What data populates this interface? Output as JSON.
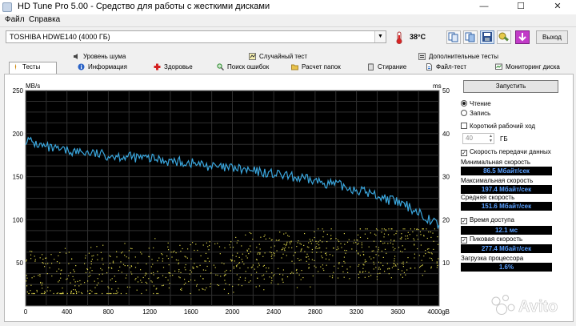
{
  "window": {
    "title": "HD Tune Pro 5.00 - Средство для работы с жесткими дисками",
    "minimize": "—",
    "maximize": "☐",
    "close": "✕"
  },
  "menu": {
    "file": "Файл",
    "help": "Справка"
  },
  "toolbar": {
    "drive": "TOSHIBA HDWE140 (4000 ГБ)",
    "temperature": "38°C",
    "exit_label": "Выход",
    "icons": [
      "copy-icon",
      "copy-all-icon",
      "save-icon",
      "options-icon",
      "download-icon"
    ]
  },
  "tabs": {
    "row1": [
      {
        "label": "Уровень шума",
        "icon": "speaker-icon"
      },
      {
        "label": "Случайный тест",
        "icon": "random-icon"
      },
      {
        "label": "Дополнительные тесты",
        "icon": "extra-tests-icon"
      }
    ],
    "row2": [
      {
        "label": "Тесты",
        "icon": "tests-icon",
        "active": true
      },
      {
        "label": "Информация",
        "icon": "info-icon"
      },
      {
        "label": "Здоровье",
        "icon": "health-icon"
      },
      {
        "label": "Поиск ошибок",
        "icon": "error-scan-icon"
      },
      {
        "label": "Расчет папок",
        "icon": "folder-icon"
      },
      {
        "label": "Стирание",
        "icon": "erase-icon"
      },
      {
        "label": "Файл-тест",
        "icon": "file-test-icon"
      },
      {
        "label": "Мониторинг диска",
        "icon": "monitor-icon"
      }
    ]
  },
  "controls": {
    "start_button": "Запустить",
    "read_label": "Чтение",
    "write_label": "Запись",
    "short_stroke_label": "Короткий рабочий ход",
    "short_stroke_value": "40",
    "short_stroke_unit": "ГБ",
    "transfer_rate_label": "Скорость передачи данных",
    "min_speed_label": "Минимальная скорость",
    "min_speed_value": "86.5 Мбайт/сек",
    "max_speed_label": "Максимальная скорость",
    "max_speed_value": "197.4 Мбайт/сек",
    "avg_speed_label": "Средняя скорость",
    "avg_speed_value": "151.6 Мбайт/сек",
    "access_time_label": "Время доступа",
    "access_time_value": "12.1 мс",
    "burst_rate_label": "Пиковая скорость",
    "burst_rate_value": "277.4 Мбайт/сек",
    "cpu_label": "Загрузка процессора",
    "cpu_value": "1.6%",
    "read_selected": true,
    "transfer_checked": true,
    "access_checked": true,
    "burst_checked": true,
    "short_stroke_checked": false
  },
  "watermark": "Avito",
  "chart_data": {
    "type": "line",
    "left_axis_unit": "MB/s",
    "right_axis_unit": "ms",
    "x_ticks": [
      "0",
      "400",
      "800",
      "1200",
      "1600",
      "2000",
      "2400",
      "2800",
      "3200",
      "3600",
      "4000gB"
    ],
    "y_left_ticks": [
      "50",
      "100",
      "150",
      "200",
      "250"
    ],
    "y_right_ticks": [
      "10",
      "20",
      "30",
      "40",
      "50"
    ],
    "xlim": [
      0,
      4000
    ],
    "ylim_left": [
      0,
      250
    ],
    "ylim_right": [
      0,
      50
    ],
    "grid": true,
    "series": [
      {
        "name": "",
        "color": "#3aa6dd",
        "x": [
          0,
          100,
          200,
          300,
          400,
          500,
          600,
          700,
          800,
          900,
          1000,
          1100,
          1200,
          1300,
          1400,
          1500,
          1600,
          1700,
          1800,
          1900,
          2000,
          2100,
          2200,
          2300,
          2400,
          2500,
          2600,
          2700,
          2800,
          2900,
          3000,
          3100,
          3200,
          3300,
          3400,
          3500,
          3600,
          3700,
          3800,
          3900,
          4000
        ],
        "y": [
          193,
          188,
          184,
          181,
          180,
          179,
          178,
          176,
          175,
          174,
          173,
          172,
          171,
          170,
          168,
          167,
          166,
          164,
          162,
          160,
          160,
          158,
          156,
          155,
          153,
          151,
          149,
          147,
          145,
          143,
          141,
          138,
          135,
          132,
          128,
          124,
          120,
          115,
          109,
          101,
          94
        ]
      }
    ],
    "access_time_scatter": {
      "color": "#d8d048",
      "x_range": [
        0,
        4000
      ],
      "trend_ms": [
        6,
        14
      ],
      "spread_ms": [
        3,
        18
      ]
    }
  }
}
